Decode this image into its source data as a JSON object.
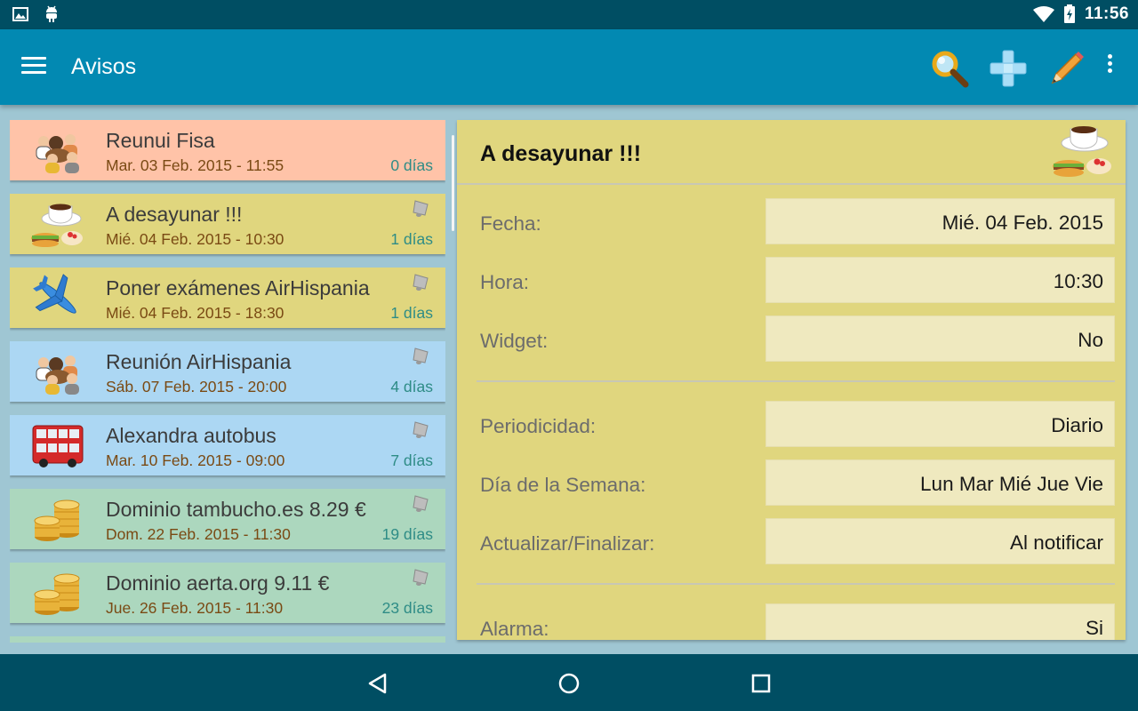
{
  "status_bar": {
    "time": "11:56",
    "left_icons": [
      "image-icon",
      "android-icon"
    ],
    "right_icons": [
      "wifi-icon",
      "battery-icon"
    ]
  },
  "app_bar": {
    "title": "Avisos",
    "actions": [
      "search-icon",
      "add-icon",
      "edit-icon",
      "overflow-menu-icon"
    ],
    "color": "#0289b2"
  },
  "list": {
    "items": [
      {
        "title": "Reunui Fisa",
        "date": "Mar. 03 Feb. 2015 - 11:55",
        "days": "0 días",
        "icon": "meeting-icon",
        "bell": false,
        "color": "#ffc3a8"
      },
      {
        "title": "A desayunar !!!",
        "date": "Mié. 04 Feb. 2015 - 10:30",
        "days": "1 días",
        "icon": "breakfast-icon",
        "bell": true,
        "color": "#e0d67e"
      },
      {
        "title": "Poner exámenes AirHispania",
        "date": "Mié. 04 Feb. 2015 - 18:30",
        "days": "1 días",
        "icon": "airplane-icon",
        "bell": true,
        "color": "#e0d67e"
      },
      {
        "title": "Reunión AirHispania",
        "date": "Sáb. 07 Feb. 2015 - 20:00",
        "days": "4 días",
        "icon": "meeting-icon",
        "bell": true,
        "color": "#acd7f3"
      },
      {
        "title": "Alexandra autobus",
        "date": "Mar. 10 Feb. 2015 - 09:00",
        "days": "7 días",
        "icon": "bus-icon",
        "bell": true,
        "color": "#acd7f3"
      },
      {
        "title": "Dominio tambucho.es 8.29 €",
        "date": "Dom. 22 Feb. 2015 - 11:30",
        "days": "19 días",
        "icon": "coins-icon",
        "bell": true,
        "color": "#acd7be"
      },
      {
        "title": "Dominio aerta.org 9.11 €",
        "date": "Jue. 26 Feb. 2015 - 11:30",
        "days": "23 días",
        "icon": "coins-icon",
        "bell": true,
        "color": "#acd7be"
      }
    ]
  },
  "detail": {
    "title": "A desayunar !!!",
    "icon": "breakfast-icon",
    "fields": [
      {
        "label": "Fecha:",
        "value": "Mié. 04 Feb. 2015"
      },
      {
        "label": "Hora:",
        "value": "10:30"
      },
      {
        "label": "Widget:",
        "value": "No"
      },
      {
        "label": "Periodicidad:",
        "value": "Diario"
      },
      {
        "label": "Día de la Semana:",
        "value": "Lun Mar Mié Jue Vie"
      },
      {
        "label": "Actualizar/Finalizar:",
        "value": "Al notificar"
      },
      {
        "label": "Alarma:",
        "value": "Si"
      }
    ]
  },
  "nav_bar": {
    "buttons": [
      "back-icon",
      "home-icon",
      "recents-icon"
    ]
  }
}
